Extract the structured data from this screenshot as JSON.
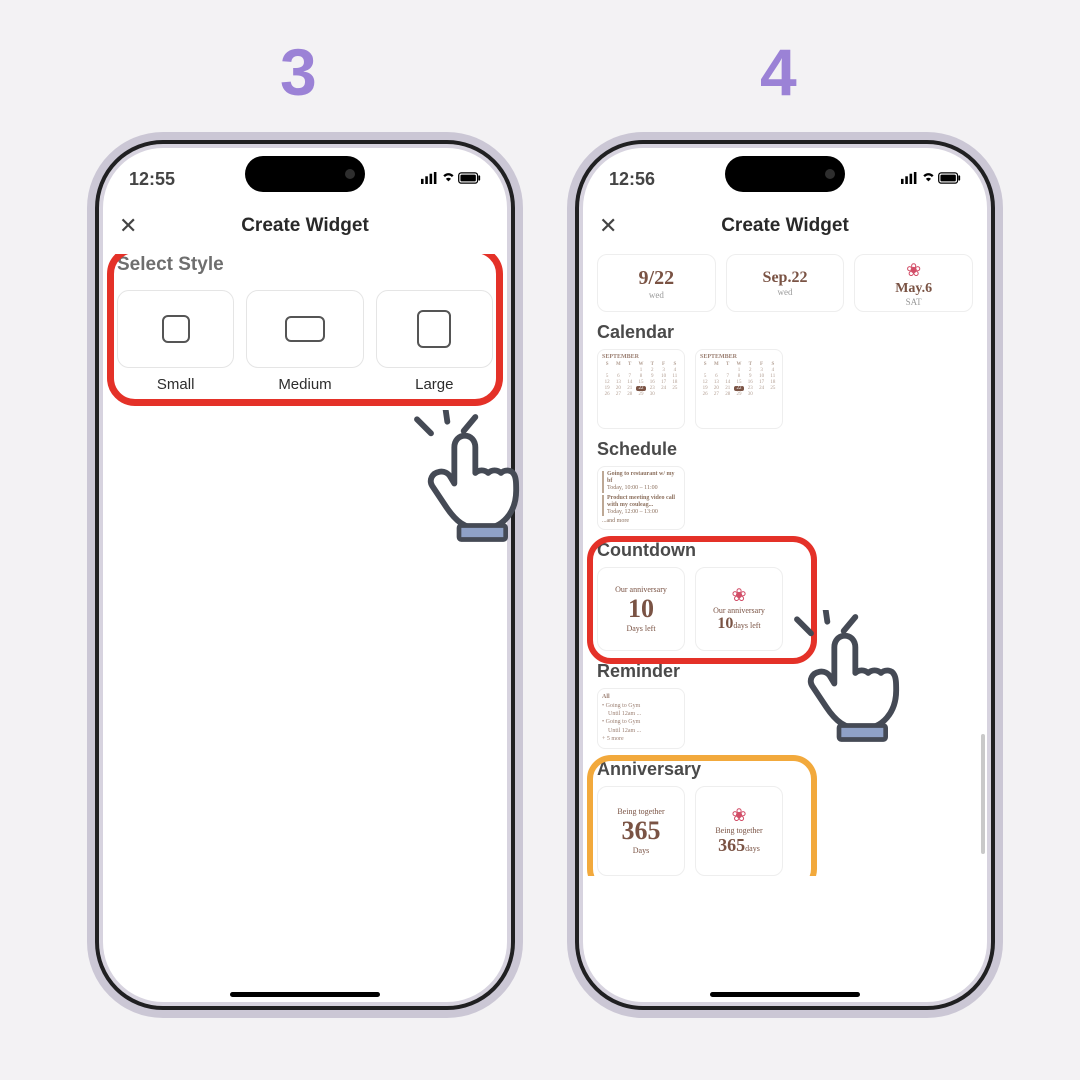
{
  "steps": {
    "left": "3",
    "right": "4"
  },
  "status3": {
    "time": "12:55"
  },
  "status4": {
    "time": "12:56"
  },
  "nav": {
    "title": "Create Widget"
  },
  "screen3": {
    "sectionLabel": "Select Style",
    "sizes": [
      "Small",
      "Medium",
      "Large"
    ]
  },
  "screen4": {
    "dateCards": [
      {
        "big": "9/22",
        "sml": "wed"
      },
      {
        "big": "Sep.22",
        "sml": "wed"
      },
      {
        "big": "May.6",
        "sml": "SAT",
        "badge": true
      }
    ],
    "calendar": {
      "title": "Calendar",
      "month": "SEPTEMBER",
      "dow": [
        "S",
        "M",
        "T",
        "W",
        "T",
        "F",
        "S"
      ]
    },
    "schedule": {
      "title": "Schedule",
      "items": [
        {
          "t": "Going to restaurant w/ my bf",
          "s": "Today, 10:00 – 11:00"
        },
        {
          "t": "Product meeting video call with my couleag...",
          "s": "Today, 12:00 – 13:00"
        }
      ],
      "more": "...and more"
    },
    "countdown": {
      "title": "Countdown",
      "card1": {
        "label": "Our anniversary",
        "value": "10",
        "unit": "Days left"
      },
      "card2": {
        "label": "Our anniversary",
        "value": "10",
        "unit": "days left"
      }
    },
    "reminder": {
      "title": "Reminder",
      "header": "All",
      "items": [
        "Going to Gym",
        "Until 12am ...",
        "Going to Gym",
        "Until 12am ..."
      ],
      "more": "+ 5 more"
    },
    "anniversary": {
      "title": "Anniversary",
      "card1": {
        "label": "Being together",
        "value": "365",
        "unit": "Days"
      },
      "card2": {
        "label": "Being together",
        "value": "365",
        "unit": "days"
      }
    }
  }
}
